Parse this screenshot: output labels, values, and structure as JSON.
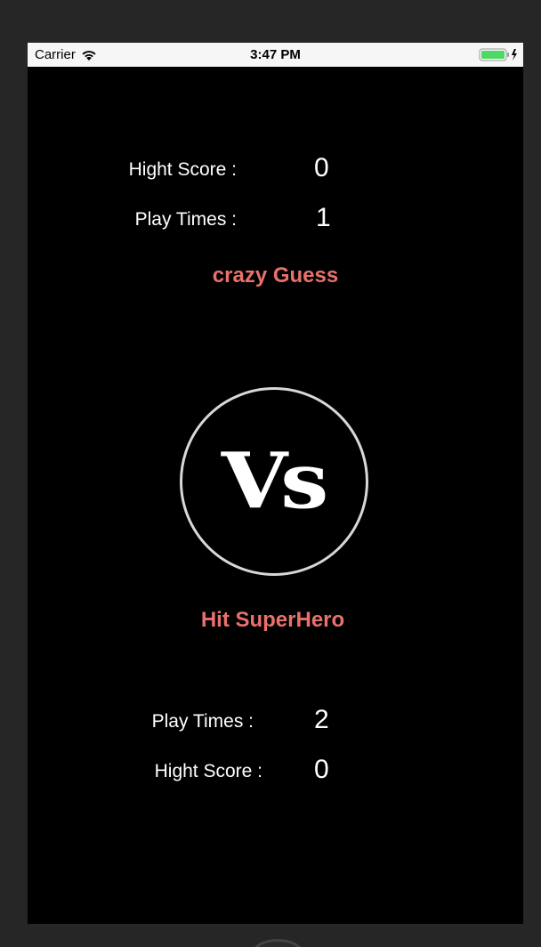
{
  "status_bar": {
    "carrier": "Carrier",
    "time": "3:47 PM",
    "wifi_icon": "wifi-icon",
    "battery_icon": "battery-charging-icon",
    "battery_color": "#4cd964"
  },
  "top_game": {
    "high_score_label": "Hight Score :",
    "high_score_value": "0",
    "play_times_label": "Play Times :",
    "play_times_value": "1",
    "title": "crazy Guess"
  },
  "vs": {
    "label": "Vs"
  },
  "bottom_game": {
    "title": "Hit SuperHero",
    "play_times_label": "Play Times :",
    "play_times_value": "2",
    "high_score_label": "Hight Score :",
    "high_score_value": "0"
  },
  "colors": {
    "accent": "#e8716b",
    "background": "#000000",
    "text": "#ffffff"
  }
}
